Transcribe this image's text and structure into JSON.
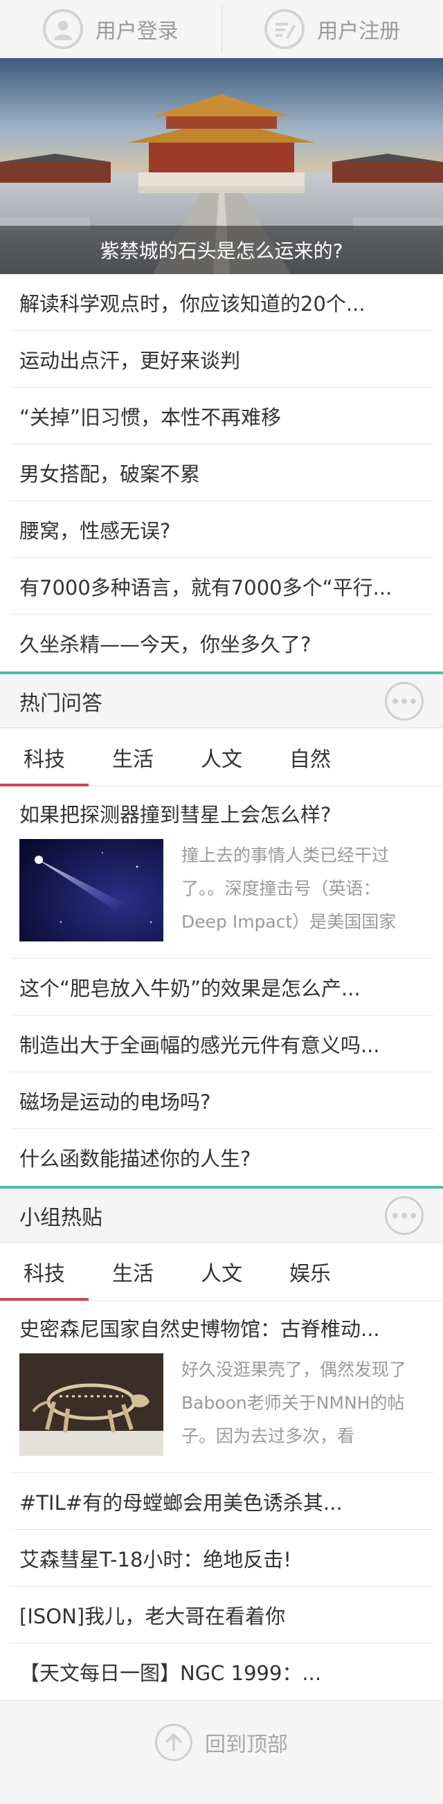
{
  "header": {
    "login_label": "用户登录",
    "register_label": "用户注册"
  },
  "hero": {
    "caption": "紫禁城的石头是怎么运来的?"
  },
  "articles": [
    "解读科学观点时，你应该知道的20个...",
    "运动出点汗，更好来谈判",
    "“关掉”旧习惯，本性不再难移",
    "男女搭配，破案不累",
    "腰窝，性感无误?",
    "有7000多种语言，就有7000多个“平行...",
    "久坐杀精——今天，你坐多久了?"
  ],
  "qa": {
    "title": "热门问答",
    "tabs": [
      "科技",
      "生活",
      "人文",
      "自然"
    ],
    "active_tab": 0,
    "feature": {
      "title": "如果把探测器撞到彗星上会怎么样?",
      "excerpt": "撞上去的事情人类已经干过了。。深度撞击号（英语：Deep Impact）是美国国家"
    },
    "items": [
      "这个“肥皂放入牛奶”的效果是怎么产...",
      "制造出大于全画幅的感光元件有意义吗...",
      "磁场是运动的电场吗?",
      "什么函数能描述你的人生?"
    ]
  },
  "groups": {
    "title": "小组热贴",
    "tabs": [
      "科技",
      "生活",
      "人文",
      "娱乐"
    ],
    "active_tab": 0,
    "feature": {
      "title": "史密森尼国家自然史博物馆：古脊椎动...",
      "excerpt": "好久没逛果壳了，偶然发现了Baboon老师关于NMNH的帖子。因为去过多次，看"
    },
    "items": [
      "#TIL#有的母螳螂会用美色诱杀其...",
      "艾森彗星T-18小时：绝地反击!",
      "[ISON]我儿，老大哥在看着你",
      "【天文每日一图】NGC 1999：..."
    ]
  },
  "footer": {
    "back_to_top_label": "回到顶部"
  },
  "colors": {
    "accent_teal": "#4bbfa6",
    "tab_underline": "#c9495a"
  }
}
